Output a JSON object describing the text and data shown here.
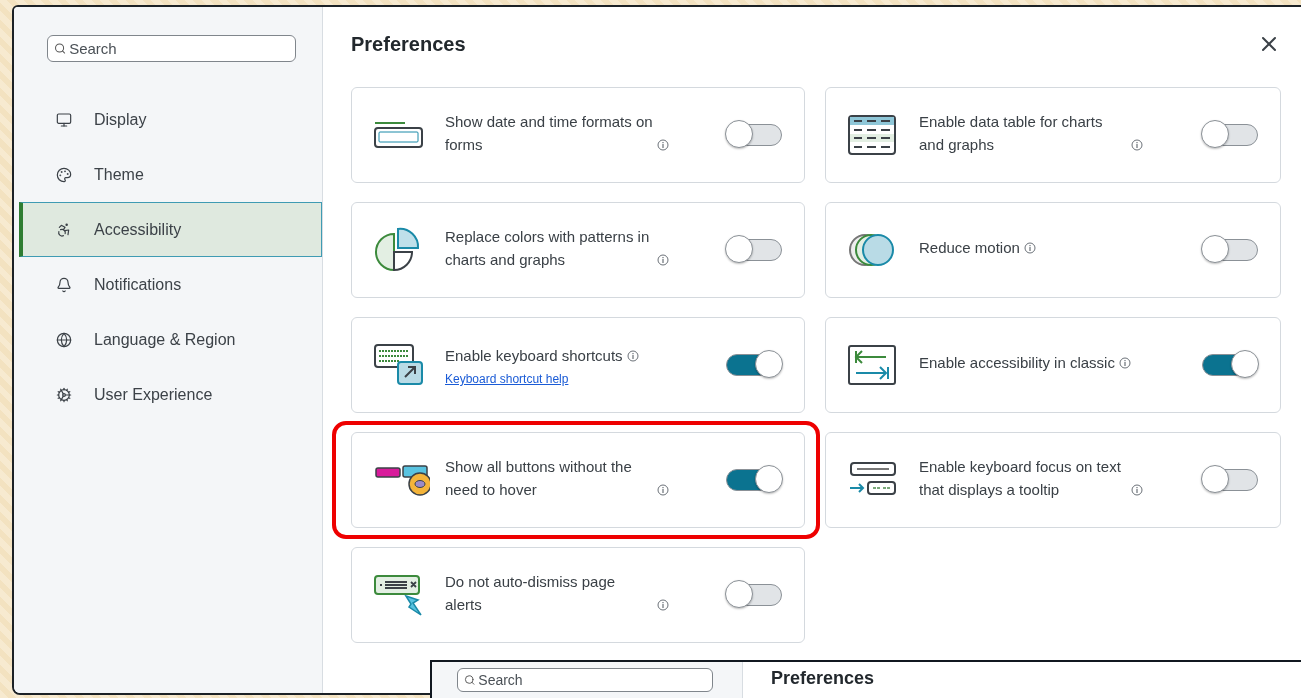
{
  "sidebar": {
    "search": {
      "placeholder": "Search"
    },
    "items": [
      {
        "label": "Display",
        "selected": false
      },
      {
        "label": "Theme",
        "selected": false
      },
      {
        "label": "Accessibility",
        "selected": true
      },
      {
        "label": "Notifications",
        "selected": false
      },
      {
        "label": "Language & Region",
        "selected": false
      },
      {
        "label": "User Experience",
        "selected": false
      }
    ]
  },
  "dialog": {
    "title": "Preferences"
  },
  "settings": [
    {
      "label": "Show date and time formats on forms",
      "on": false,
      "highlighted": false
    },
    {
      "label": "Enable data table for charts and graphs",
      "on": false,
      "highlighted": false
    },
    {
      "label": "Replace colors with patterns in charts and graphs",
      "on": false,
      "highlighted": false
    },
    {
      "label": "Reduce motion",
      "on": false,
      "highlighted": false
    },
    {
      "label": "Enable keyboard shortcuts",
      "on": true,
      "highlighted": false,
      "link": "Keyboard shortcut help"
    },
    {
      "label": "Enable accessibility in classic",
      "on": true,
      "highlighted": false
    },
    {
      "label": "Show all buttons without the need to hover",
      "on": true,
      "highlighted": true
    },
    {
      "label": "Enable keyboard focus on text that displays a tooltip",
      "on": false,
      "highlighted": false
    },
    {
      "label": "Do not auto-dismiss page alerts",
      "on": false,
      "highlighted": false
    }
  ],
  "background_window": {
    "search": {
      "placeholder": "Search"
    },
    "title": "Preferences"
  }
}
